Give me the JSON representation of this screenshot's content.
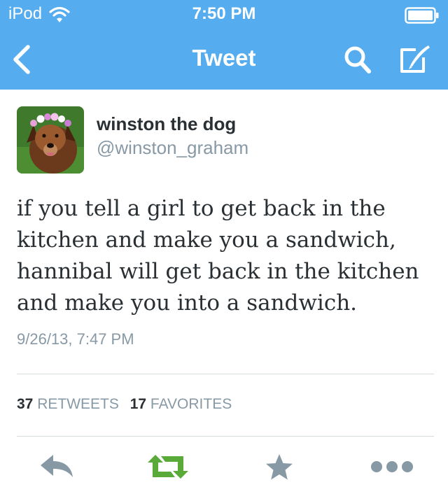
{
  "status_bar": {
    "carrier": "iPod",
    "time": "7:50 PM"
  },
  "nav": {
    "title": "Tweet"
  },
  "colors": {
    "bar": "#55acee",
    "retweet": "#5aaa3a",
    "muted": "#8899a6"
  },
  "icons": [
    "wifi-icon",
    "battery-icon",
    "back-chevron-icon",
    "search-icon",
    "compose-icon",
    "reply-icon",
    "retweet-icon",
    "star-icon",
    "more-dots-icon"
  ],
  "tweet": {
    "display_name": "winston the dog",
    "handle": "@winston_graham",
    "lines": [
      "if you tell a girl to get back in the",
      "kitchen and make you a sandwich,",
      "hannibal will get back in the kitchen",
      "and make you into a sandwich."
    ],
    "timestamp": "9/26/13, 7:47 PM"
  },
  "stats": {
    "retweets_count": "37",
    "retweets_label": "RETWEETS",
    "favorites_count": "17",
    "favorites_label": "FAVORITES"
  }
}
